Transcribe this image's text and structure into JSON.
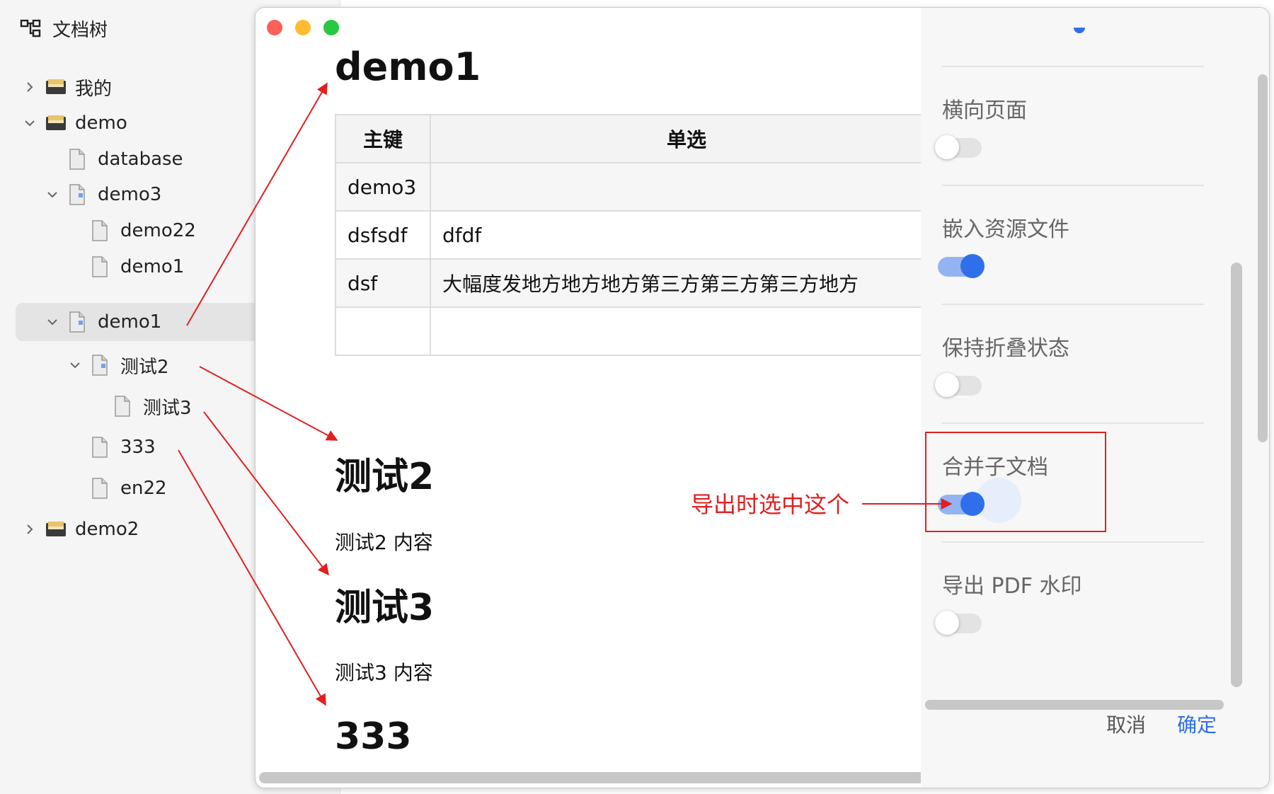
{
  "sidebar": {
    "title": "文档树",
    "items": [
      {
        "label": "我的",
        "type": "book",
        "expanded": false
      },
      {
        "label": "demo",
        "type": "book",
        "expanded": true
      },
      {
        "label": "database",
        "type": "doc"
      },
      {
        "label": "demo3",
        "type": "folder-doc",
        "expanded": true
      },
      {
        "label": "demo22",
        "type": "doc"
      },
      {
        "label": "demo1",
        "type": "doc"
      },
      {
        "label": "demo1",
        "type": "folder-doc",
        "expanded": true,
        "selected": true
      },
      {
        "label": "测试2",
        "type": "folder-doc",
        "expanded": true
      },
      {
        "label": "测试3",
        "type": "doc"
      },
      {
        "label": "333",
        "type": "doc"
      },
      {
        "label": "en22",
        "type": "doc"
      },
      {
        "label": "demo2",
        "type": "book",
        "expanded": false
      }
    ]
  },
  "preview": {
    "title": "demo1",
    "table": {
      "headers": [
        "主键",
        "单选"
      ],
      "rows": [
        [
          "demo3",
          ""
        ],
        [
          "dsfsdf",
          "dfdf"
        ],
        [
          "dsf",
          "大幅度发地方地方地方第三方第三方第三方地方"
        ],
        [
          "",
          ""
        ]
      ]
    },
    "sections": [
      {
        "heading": "测试2",
        "content": "测试2 内容"
      },
      {
        "heading": "测试3",
        "content": "测试3 内容"
      },
      {
        "heading": "333",
        "content": ""
      }
    ]
  },
  "export_panel": {
    "options": [
      {
        "label": "横向页面",
        "enabled": false
      },
      {
        "label": "嵌入资源文件",
        "enabled": true
      },
      {
        "label": "保持折叠状态",
        "enabled": false
      },
      {
        "label": "合并子文档",
        "enabled": true
      },
      {
        "label": "导出 PDF 水印",
        "enabled": false
      }
    ],
    "cancel_label": "取消",
    "confirm_label": "确定"
  },
  "annotation": {
    "text": "导出时选中这个",
    "color": "#e02020"
  },
  "colors": {
    "accent": "#2f6fea",
    "toggle_on_track": "#93b4f0",
    "annotation": "#e02020",
    "traffic_red": "#fe5f57",
    "traffic_yellow": "#febc2e",
    "traffic_green": "#28c840"
  }
}
